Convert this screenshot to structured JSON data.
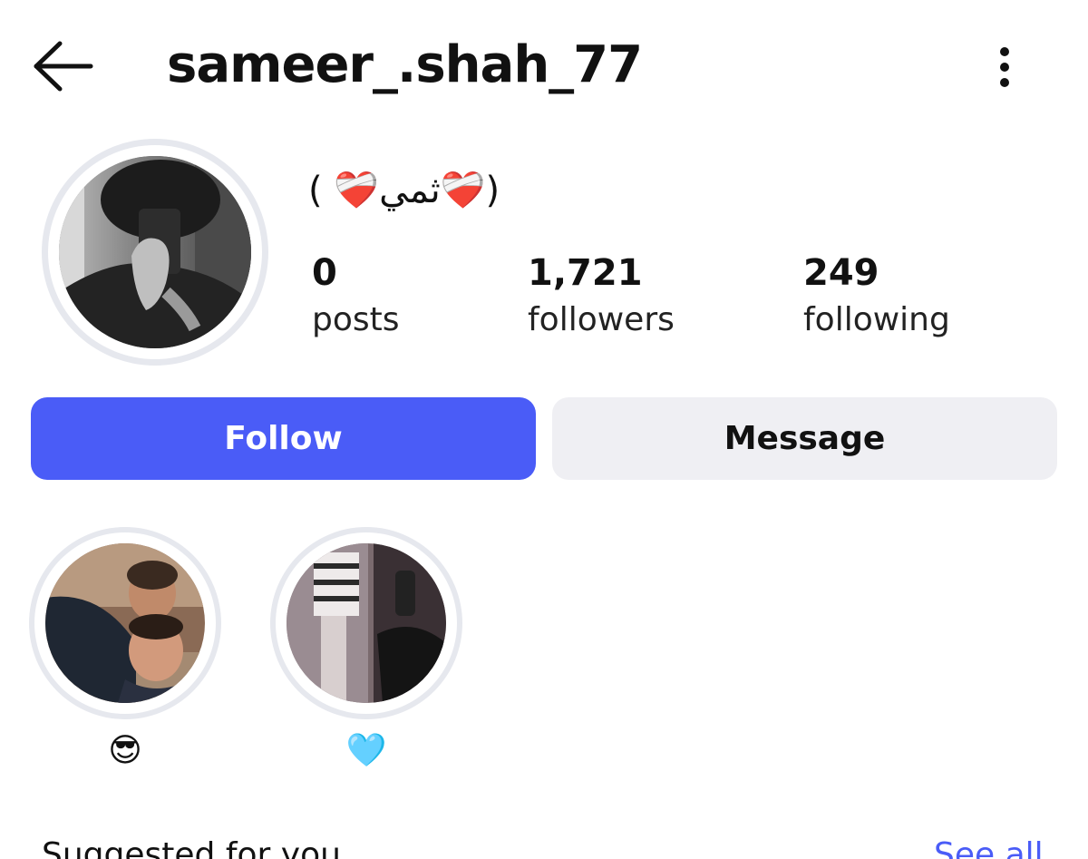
{
  "header": {
    "username": "sameer_.shah_77",
    "back_icon": "arrow-left-icon",
    "more_icon": "vertical-dots-icon"
  },
  "profile": {
    "bio": "( ❤️‍🩹ثمي❤️‍🩹)",
    "stats": [
      {
        "value": "0",
        "label": "posts"
      },
      {
        "value": "1,721",
        "label": "followers"
      },
      {
        "value": "249",
        "label": "following"
      }
    ]
  },
  "actions": {
    "follow_label": "Follow",
    "message_label": "Message"
  },
  "highlights": [
    {
      "label": "😎"
    },
    {
      "label": "🩵"
    }
  ],
  "suggested": {
    "title": "Suggested for you",
    "see_all": "See all"
  },
  "colors": {
    "accent": "#4a5cf7",
    "secondary_button": "#efeff3",
    "ring": "#e6e8ee"
  }
}
